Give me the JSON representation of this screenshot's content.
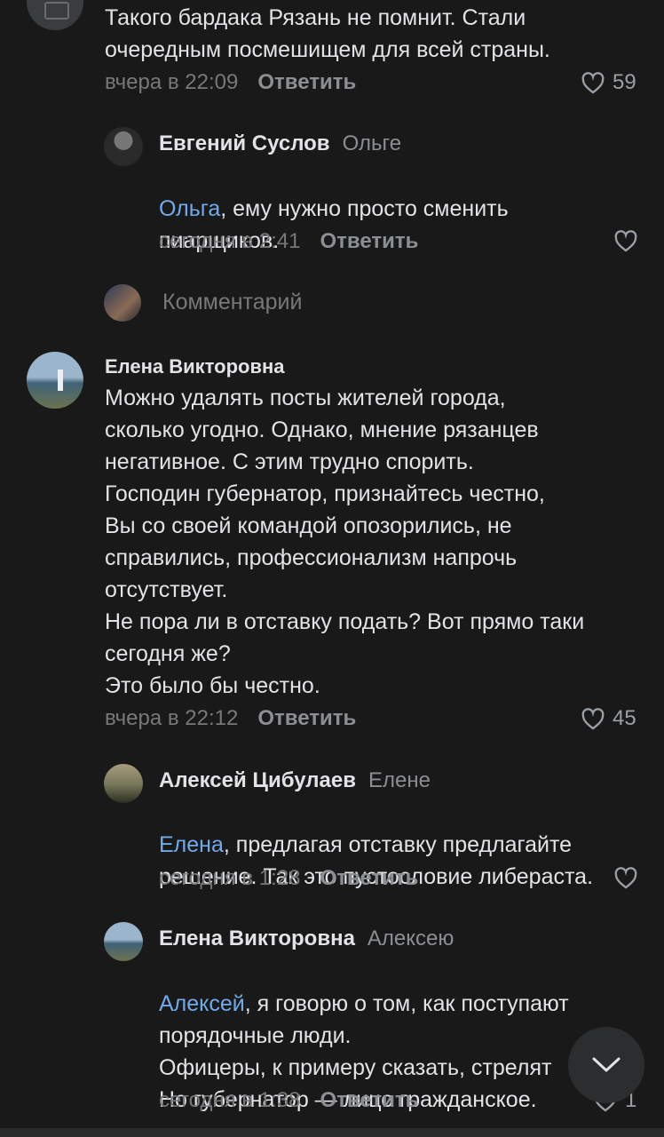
{
  "comments": [
    {
      "text": "Такого бардака Рязань не помнит. Стали\nочередным посмешищем для всей страны.",
      "time": "вчера в 22:09",
      "reply_label": "Ответить",
      "likes": "59"
    },
    {
      "author": "Евгений Суслов",
      "reply_to": "Ольге",
      "mention": "Ольга",
      "text": ", ему нужно просто сменить\nпиарщиков.",
      "time": "сегодня в 2:41",
      "reply_label": "Ответить"
    },
    {
      "author": "Елена Викторовна",
      "text": "Можно удалять посты жителей города,\nсколько угодно. Однако, мнение рязанцев\nнегативное. С этим трудно спорить.\nГосподин губернатор, признайтесь честно,\nВы со своей командой опозорились, не\nсправились, профессионализм напрочь\nотсутствует.\nНе пора ли в отставку подать? Вот прямо таки\nсегодня же?\nЭто было бы честно.",
      "time": "вчера в 22:12",
      "reply_label": "Ответить",
      "likes": "45"
    },
    {
      "author": "Алексей Цибулаев",
      "reply_to": "Елене",
      "mention": "Елена",
      "text": ", предлагая отставку предлагайте\nрешение. Так это пустословие либераста.",
      "time": "сегодня в 1:28",
      "reply_label": "Ответить"
    },
    {
      "author": "Елена Викторовна",
      "reply_to": "Алексею",
      "mention": "Алексей",
      "text": ", я говорю о том, как поступают\nпорядочные люди.\nОфицеры, к примеру сказать, стрелят\nНо губернатор — лицо гражданское.",
      "time": "сегодня в 1:38",
      "reply_label": "Ответить",
      "likes": "1"
    }
  ],
  "composer": {
    "placeholder": "Комментарий"
  },
  "icons": {
    "like": "heart-outline-icon",
    "scroll": "chevron-down-icon"
  },
  "colors": {
    "background": "#191919",
    "text": "#e1e3e6",
    "secondary": "#76787a",
    "mention": "#71aaeb"
  }
}
